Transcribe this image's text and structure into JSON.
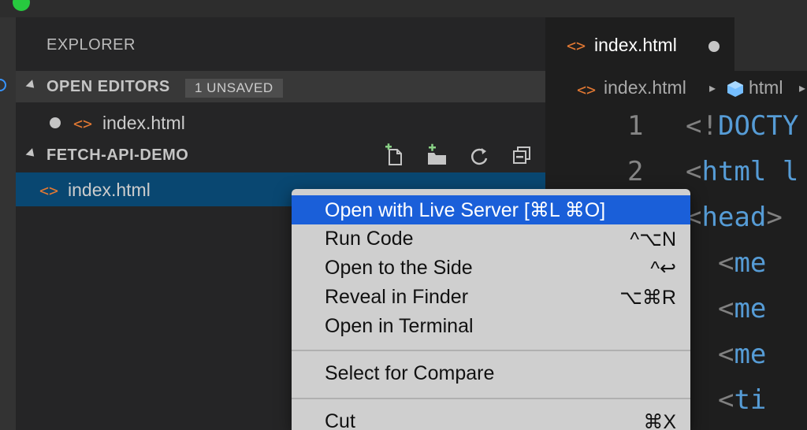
{
  "sidebar": {
    "title": "EXPLORER",
    "open_editors": {
      "label": "OPEN EDITORS",
      "badge": "1 UNSAVED",
      "file": "index.html"
    },
    "folder": {
      "label": "FETCH-API-DEMO",
      "file": "index.html"
    },
    "tools": [
      "new-file-icon",
      "new-folder-icon",
      "refresh-icon",
      "collapse-all-icon"
    ]
  },
  "editor": {
    "tab": "index.html",
    "breadcrumb": {
      "file": "index.html",
      "symbol": "html"
    },
    "lines": [
      {
        "num": "1",
        "open": "<",
        "bang": "!",
        "kw": "DOCTY"
      },
      {
        "num": "2",
        "open": "<",
        "kw": "html",
        "rest": " l"
      },
      {
        "open": "<",
        "kw": "head",
        "rest": "> "
      },
      {
        "indent": "  ",
        "open": "<",
        "kw": "me"
      },
      {
        "indent": "  ",
        "open": "<",
        "kw": "me"
      },
      {
        "indent": "  ",
        "open": "<",
        "kw": "me"
      },
      {
        "indent": "  ",
        "open": "<",
        "kw": "ti"
      }
    ]
  },
  "context_menu": {
    "items": [
      {
        "label": "Open with Live Server [⌘L ⌘O]",
        "shortcut": ""
      },
      {
        "label": "Run Code",
        "shortcut": "^⌥N"
      },
      {
        "label": "Open to the Side",
        "shortcut": "^↩"
      },
      {
        "label": "Reveal in Finder",
        "shortcut": "⌥⌘R"
      },
      {
        "label": "Open in Terminal",
        "shortcut": ""
      },
      {
        "label": "Select for Compare",
        "shortcut": ""
      },
      {
        "label": "Cut",
        "shortcut": "⌘X"
      }
    ]
  },
  "colors": {
    "accent": "#094771",
    "menu_highlight": "#1a5fd9",
    "html_icon": "#e37933",
    "keyword": "#569cd6"
  }
}
